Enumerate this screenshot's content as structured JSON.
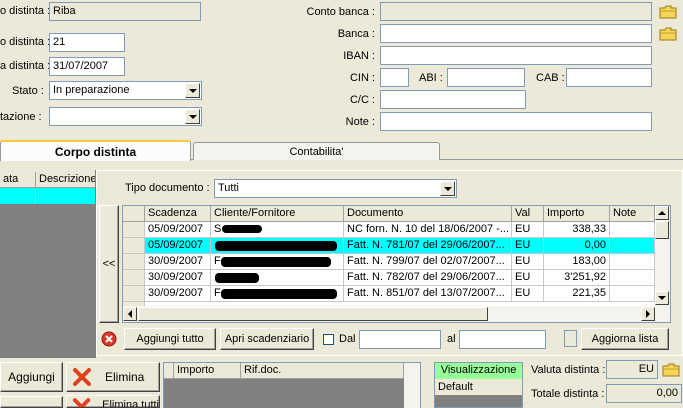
{
  "header_form": {
    "tipo_label": "o distinta :",
    "tipo_value": "Riba",
    "numero_label": "o distinta :",
    "numero_value": "21",
    "data_label": "a distinta :",
    "data_value": "31/07/2007",
    "stato_label": "Stato :",
    "stato_value": "In preparazione",
    "presentazione_label": "tazione :",
    "presentazione_value": "",
    "conto_banca_label": "Conto banca :",
    "conto_banca_value": "",
    "banca_label": "Banca :",
    "banca_value": "",
    "iban_label": "IBAN :",
    "iban_value": "",
    "cin_label": "CIN :",
    "cin_value": "",
    "abi_label": "ABI :",
    "abi_value": "",
    "cab_label": "CAB :",
    "cab_value": "",
    "cc_label": "C/C :",
    "cc_value": "",
    "note_label": "Note :",
    "note_value": ""
  },
  "tabs": [
    {
      "label": "Corpo distinta",
      "active": true
    },
    {
      "label": "Contabilita'",
      "active": false
    }
  ],
  "left_grid": {
    "columns": [
      "ata",
      "Descrizione"
    ]
  },
  "scadenze_panel": {
    "tipo_documento_label": "Tipo documento :",
    "tipo_documento_value": "Tutti",
    "collapse_label": "<<",
    "columns": [
      "Scadenza",
      "Cliente/Fornitore",
      "Documento",
      "Val",
      "Importo",
      "Note"
    ],
    "rows": [
      {
        "scadenza": "05/09/2007",
        "cliente": "S",
        "documento": "NC forn. N. 10 del 18/06/2007 -...",
        "val": "EU",
        "importo": "338,33",
        "note": "",
        "selected": false
      },
      {
        "scadenza": "05/09/2007",
        "cliente": "",
        "documento": "Fatt. N. 781/07 del 29/06/2007...",
        "val": "EU",
        "importo": "0,00",
        "note": "",
        "selected": true
      },
      {
        "scadenza": "30/09/2007",
        "cliente": "F",
        "documento": "Fatt. N. 799/07 del 02/07/2007...",
        "val": "EU",
        "importo": "183,00",
        "note": "",
        "selected": false
      },
      {
        "scadenza": "30/09/2007",
        "cliente": "",
        "documento": "Fatt. N. 782/07 del 29/06/2007...",
        "val": "EU",
        "importo": "3'251,92",
        "note": "",
        "selected": false
      },
      {
        "scadenza": "30/09/2007",
        "cliente": "F",
        "documento": "Fatt. N. 851/07 del 13/07/2007...",
        "val": "EU",
        "importo": "221,35",
        "note": "",
        "selected": false
      }
    ],
    "aggiungi_tutto_label": "Aggiungi tutto",
    "apri_scadenziario_label": "Apri scadenziario",
    "dal_label": "Dal",
    "dal_value": "",
    "al_label": "al",
    "al_value": "",
    "aggiorna_lista_label": "Aggiorna lista"
  },
  "bottom": {
    "aggiungi_label": "Aggiungi",
    "elimina_label": "Elimina",
    "elimina_tutti_label": "Elimina tutti",
    "detail_columns": [
      "Importo",
      "Rif.doc."
    ],
    "visualizzazione_label": "Visualizzazione",
    "view_items": [
      "Default"
    ],
    "valuta_label": "Valuta distinta :",
    "valuta_value": "EU",
    "totale_label": "Totale distinta :",
    "totale_value": "0,00"
  },
  "colors": {
    "selection": "#00ffff",
    "visualizzazione_bg": "#99ff99",
    "list_dark": "#808080"
  }
}
